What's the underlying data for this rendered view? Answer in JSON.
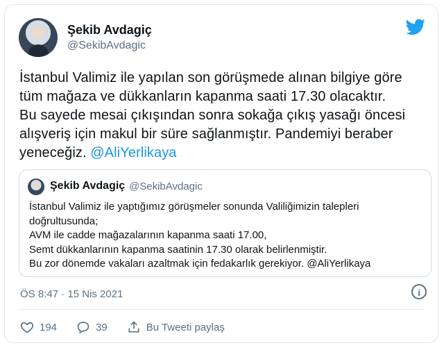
{
  "author": {
    "name": "Şekib Avdagiç",
    "handle": "@SekibAvdagic"
  },
  "tweet": {
    "lines": [
      "İstanbul Valimiz ile yapılan son görüşmede alınan bilgiye göre",
      "tüm mağaza ve dükkanların kapanma saati 17.30 olacaktır.",
      "Bu sayede mesai çıkışından sonra sokağa çıkış yasağı öncesi",
      "alışveriş için makul bir süre sağlanmıştır. Pandemiyi beraber"
    ],
    "last_line_text": "yeneceğiz. ",
    "mention": "@AliYerlikaya"
  },
  "quoted": {
    "name": "Şekib Avdagiç",
    "handle": "@SekibAvdagic",
    "lines": [
      "İstanbul Valimiz ile yaptığımız görüşmeler sonunda Valiliğimizin talepleri",
      "doğrultusunda;",
      "AVM ile cadde mağazalarının kapanma saati 17.00,",
      "Semt dükkanlarının kapanma saatinin 17.30 olarak belirlenmiştir.",
      "Bu zor dönemde vakaları azaltmak için fedakarlık gerekiyor. @AliYerlikaya"
    ]
  },
  "timestamp": "ÖS 8:47 · 15 Nis 2021",
  "actions": {
    "likes": "194",
    "replies": "39",
    "share": "Bu Tweeti paylaş"
  },
  "colors": {
    "accent": "#1b95e0",
    "muted": "#5b7083",
    "border": "#e1e8ed"
  },
  "icons": [
    "twitter-bird-icon",
    "info-icon",
    "heart-icon",
    "reply-icon",
    "share-icon"
  ]
}
